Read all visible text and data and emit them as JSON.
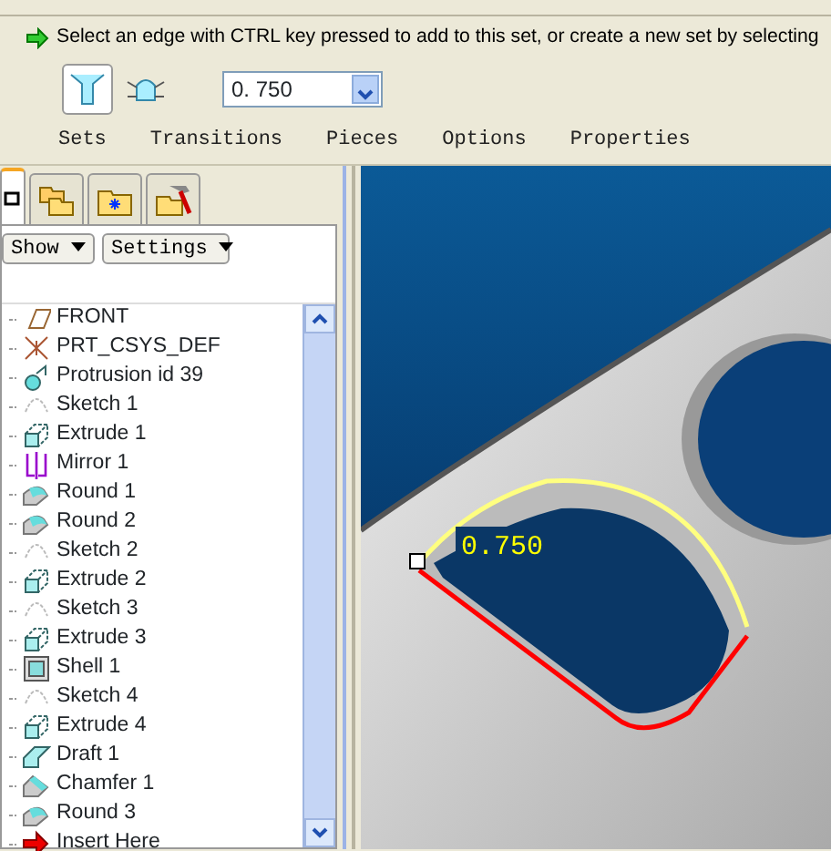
{
  "prompt": "Select an edge with CTRL key pressed to add to this set, or create a new set by selecting",
  "dashboard": {
    "modes": [
      {
        "kind": "set",
        "selected": true
      },
      {
        "kind": "transition",
        "selected": false
      }
    ],
    "radius": "0. 750",
    "tabs": [
      {
        "label": "Sets",
        "selected": false
      },
      {
        "label": "Transitions",
        "selected": false
      },
      {
        "label": "Pieces",
        "selected": false
      },
      {
        "label": "Options",
        "selected": false
      },
      {
        "label": "Properties",
        "selected": false
      }
    ]
  },
  "navigator": {
    "tabs": [
      {
        "kind": "tree",
        "selected": true
      },
      {
        "kind": "folders",
        "selected": false
      },
      {
        "kind": "favorites",
        "selected": false
      },
      {
        "kind": "tools",
        "selected": false
      }
    ],
    "buttons": [
      "Show",
      "Settings"
    ],
    "items": [
      {
        "kind": "plane",
        "label": "FRONT"
      },
      {
        "kind": "csys",
        "label": "PRT_CSYS_DEF"
      },
      {
        "kind": "protrusion",
        "label": "Protrusion id 39"
      },
      {
        "kind": "sketch",
        "label": "Sketch 1"
      },
      {
        "kind": "extrude",
        "label": "Extrude 1"
      },
      {
        "kind": "mirror",
        "label": "Mirror 1"
      },
      {
        "kind": "round",
        "label": "Round 1"
      },
      {
        "kind": "round",
        "label": "Round 2"
      },
      {
        "kind": "sketch",
        "label": "Sketch 2"
      },
      {
        "kind": "extrude",
        "label": "Extrude 2"
      },
      {
        "kind": "sketch",
        "label": "Sketch 3"
      },
      {
        "kind": "extrude",
        "label": "Extrude 3"
      },
      {
        "kind": "shell",
        "label": "Shell 1"
      },
      {
        "kind": "sketch",
        "label": "Sketch 4"
      },
      {
        "kind": "extrude",
        "label": "Extrude 4"
      },
      {
        "kind": "draft",
        "label": "Draft 1"
      },
      {
        "kind": "chamfer",
        "label": "Chamfer 1"
      },
      {
        "kind": "round",
        "label": "Round 3"
      },
      {
        "kind": "insert",
        "label": "Insert Here"
      }
    ]
  },
  "viewport": {
    "dimension": "0.750"
  }
}
